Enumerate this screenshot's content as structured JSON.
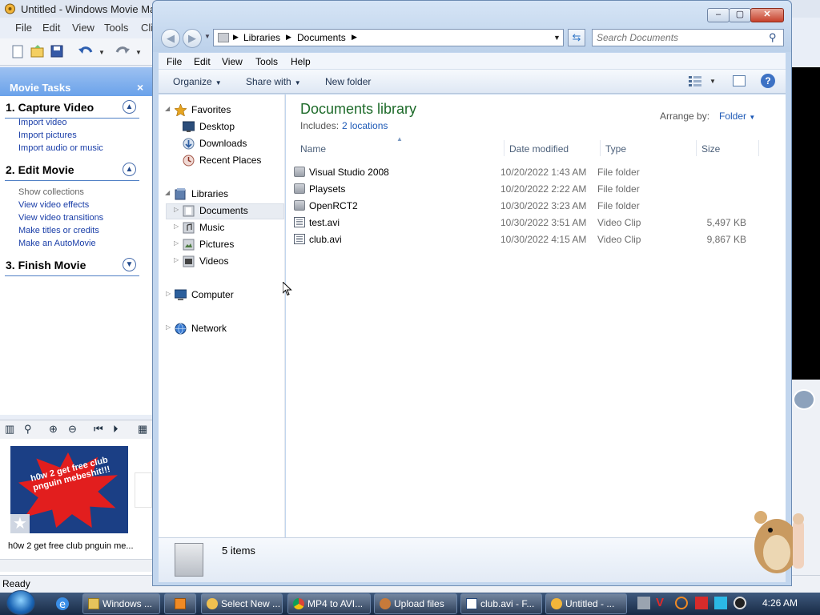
{
  "movie_maker": {
    "title": "Untitled - Windows Movie Mak",
    "menu": [
      "File",
      "Edit",
      "View",
      "Tools",
      "Cli"
    ],
    "tasks_header": "Movie Tasks",
    "sections": [
      {
        "title": "1. Capture Video",
        "toggle": "▲",
        "links": [
          "Import video",
          "Import pictures",
          "Import audio or music"
        ]
      },
      {
        "title": "2. Edit Movie",
        "toggle": "▲",
        "static": "Show collections",
        "links": [
          "View video effects",
          "View video transitions",
          "Make titles or credits",
          "Make an AutoMovie"
        ]
      },
      {
        "title": "3. Finish Movie",
        "toggle": "▼"
      }
    ],
    "clip_art_text": "h0w 2 get free club pnguin mebeshit!!!",
    "clip_caption": "h0w 2 get free club pnguin me...",
    "status": "Ready"
  },
  "explorer": {
    "breadcrumbs": [
      "Libraries",
      "Documents"
    ],
    "search_placeholder": "Search Documents",
    "menu": [
      "File",
      "Edit",
      "View",
      "Tools",
      "Help"
    ],
    "toolbar": {
      "organize": "Organize",
      "share": "Share with",
      "new_folder": "New folder"
    },
    "nav": {
      "favorites": "Favorites",
      "desktop": "Desktop",
      "downloads": "Downloads",
      "recent": "Recent Places",
      "libraries": "Libraries",
      "documents": "Documents",
      "music": "Music",
      "pictures": "Pictures",
      "videos": "Videos",
      "computer": "Computer",
      "network": "Network"
    },
    "library_title": "Documents library",
    "includes_label": "Includes:",
    "includes_link": "2 locations",
    "arrange_label": "Arrange by:",
    "arrange_value": "Folder",
    "columns": [
      "Name",
      "Date modified",
      "Type",
      "Size"
    ],
    "files": [
      {
        "name": "Visual Studio 2008",
        "date": "10/20/2022 1:43 AM",
        "type": "File folder",
        "size": "",
        "kind": "folder"
      },
      {
        "name": "Playsets",
        "date": "10/20/2022 2:22 AM",
        "type": "File folder",
        "size": "",
        "kind": "folder"
      },
      {
        "name": "OpenRCT2",
        "date": "10/30/2022 3:23 AM",
        "type": "File folder",
        "size": "",
        "kind": "folder"
      },
      {
        "name": "test.avi",
        "date": "10/30/2022 3:51 AM",
        "type": "Video Clip",
        "size": "5,497 KB",
        "kind": "video"
      },
      {
        "name": "club.avi",
        "date": "10/30/2022 4:15 AM",
        "type": "Video Clip",
        "size": "9,867 KB",
        "kind": "video"
      }
    ],
    "item_count": "5 items"
  },
  "taskbar": {
    "buttons": [
      "Windows ...",
      "",
      "Select New ...",
      "MP4 to AVI...",
      "Upload files",
      "club.avi - F...",
      "Untitled - ..."
    ],
    "clock": "4:26 AM"
  },
  "colors": {
    "library_title": "#1e6b2a",
    "link": "#1d59b6",
    "task_link": "#1a3ea8",
    "taskbar": "#2a4263"
  }
}
